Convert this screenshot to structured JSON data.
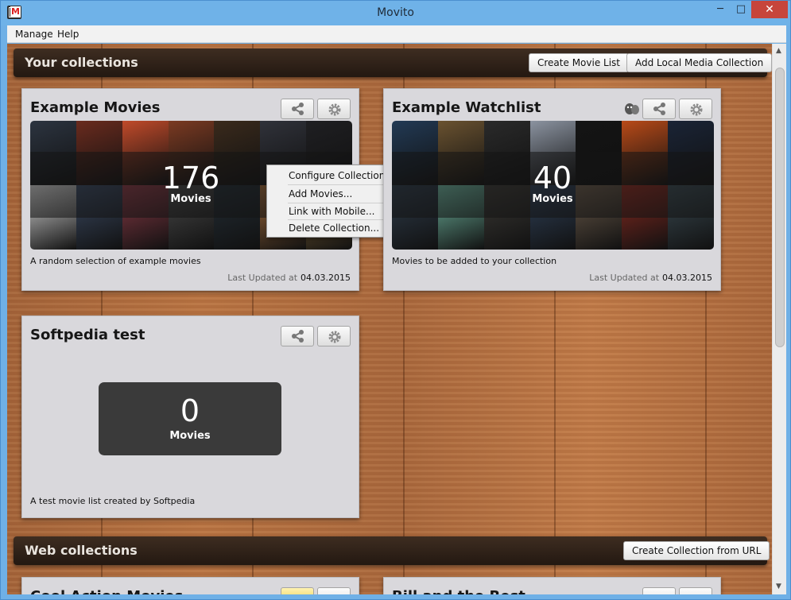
{
  "window": {
    "title": "Movito",
    "minimize": "─",
    "maximize": "□",
    "close": "✕"
  },
  "menu": {
    "items": [
      "Manage",
      "Help"
    ]
  },
  "your_collections": {
    "title": "Your collections",
    "create_movie_list": "Create Movie List",
    "add_local_media": "Add Local Media Collection"
  },
  "collections": [
    {
      "title": "Example Movies",
      "count": "176",
      "count_label": "Movies",
      "description": "A random selection of example movies",
      "updated_label": "Last Updated at",
      "updated_date": "04.03.2015",
      "posters": [
        "#2c3440",
        "#6a2b1e",
        "#c04a2a",
        "#7b3a22",
        "#3a2a1c",
        "#30323a",
        "#1f1f22",
        "#d9d9d9",
        "#3b4a63",
        "#8a3a46",
        "#4a4a4a",
        "#232d35",
        "#a06a3b",
        "#8a6a3a"
      ]
    },
    {
      "title": "Example Watchlist",
      "count": "40",
      "count_label": "Movies",
      "description": "Movies to be added to your collection",
      "updated_label": "Last Updated at",
      "updated_date": "04.03.2015",
      "posters": [
        "#223a55",
        "#6a5230",
        "#2a2a2a",
        "#8b93a0",
        "#141414",
        "#b84a18",
        "#1a2436",
        "#2f3d4c",
        "#6fb6a0",
        "#3c3a36",
        "#30425a",
        "#6a5a4a",
        "#8a2a20",
        "#3a4a52"
      ]
    },
    {
      "title": "Softpedia test",
      "count": "0",
      "count_label": "Movies",
      "description": "A test movie list created by Softpedia"
    }
  ],
  "context_menu": {
    "items": [
      "Configure Collection...",
      "Add Movies...",
      "Link with Mobile...",
      "Delete Collection..."
    ]
  },
  "web_collections": {
    "title": "Web collections",
    "create_from_url": "Create Collection from URL"
  },
  "web_cards": [
    {
      "title": "Cool Action Movies"
    },
    {
      "title": "Bill and the Rest"
    }
  ],
  "colors": {
    "section_bar": "#2f2219",
    "card_bg": "#d9d8dc",
    "close_button": "#c7453b"
  }
}
